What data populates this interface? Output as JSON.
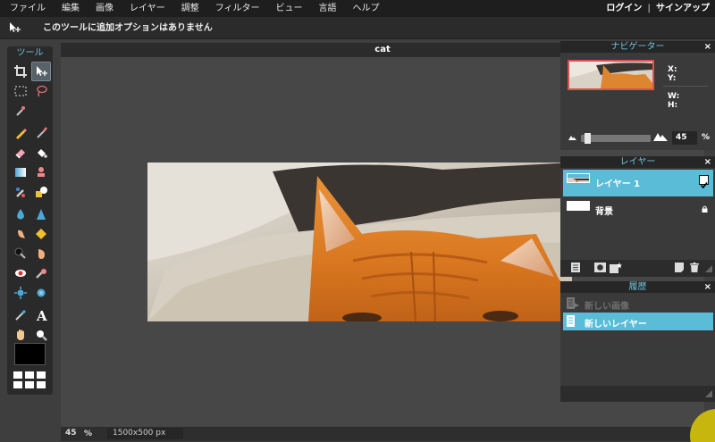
{
  "menu": {
    "items": [
      "ファイル",
      "編集",
      "画像",
      "レイヤー",
      "調整",
      "フィルター",
      "ビュー",
      "言語",
      "ヘルプ"
    ],
    "login": "ログイン",
    "divider": "|",
    "signup": "サインアップ"
  },
  "options": {
    "tool_icon": "move-tool-icon",
    "message": "このツールに追加オプションはありません"
  },
  "toolbox": {
    "title": "ツール",
    "tools": [
      "crop-icon",
      "move-icon",
      "marquee-icon",
      "lasso-icon",
      "magic-wand-icon",
      "pencil-icon",
      "brush-icon",
      "eraser-icon",
      "paint-bucket-icon",
      "gradient-icon",
      "clone-stamp-icon",
      "color-replace-icon",
      "drawing-icon",
      "blur-icon",
      "sharpen-icon",
      "smudge-icon",
      "sponge-icon",
      "dodge-icon",
      "burn-icon",
      "red-eye-icon",
      "spot-heal-icon",
      "bloat-icon",
      "pinch-icon",
      "color-picker-icon",
      "type-icon",
      "hand-icon",
      "zoom-icon"
    ],
    "foreground_color": "#000000"
  },
  "document": {
    "title": "cat",
    "zoom": "45",
    "zoom_unit": "%",
    "size": "1500x500 px"
  },
  "navigator": {
    "title": "ナビゲーター",
    "x_label": "X:",
    "y_label": "Y:",
    "w_label": "W:",
    "h_label": "H:",
    "zoom": "45",
    "zoom_unit": "%",
    "zoom_level": 0.05
  },
  "layers": {
    "title": "レイヤー",
    "items": [
      {
        "name": "レイヤー 1",
        "selected": true,
        "visible": true
      },
      {
        "name": "背景",
        "selected": false,
        "locked": true
      }
    ]
  },
  "history": {
    "title": "履歴",
    "items": [
      {
        "name": "新しい画像",
        "selected": false
      },
      {
        "name": "新しいレイヤー",
        "selected": true
      }
    ]
  },
  "colors": {
    "accent": "#5bbcd8",
    "panel_title": "#6fc3dd",
    "menubar": "#1e1e1e"
  }
}
